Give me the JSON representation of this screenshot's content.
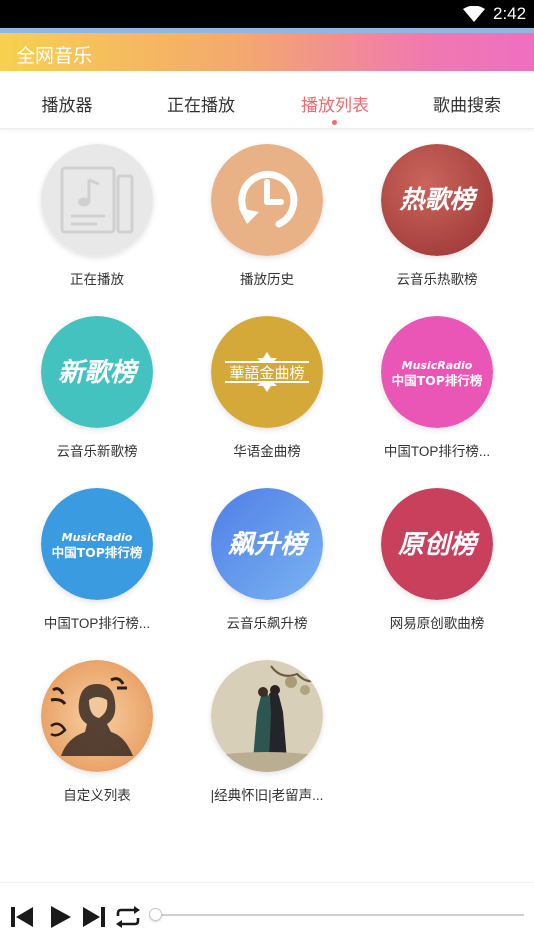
{
  "status": {
    "time": "2:42"
  },
  "app": {
    "title": "全网音乐"
  },
  "tabs": [
    {
      "label": "播放器",
      "active": false
    },
    {
      "label": "正在播放",
      "active": false
    },
    {
      "label": "播放列表",
      "active": true
    },
    {
      "label": "歌曲搜索",
      "active": false
    }
  ],
  "playlists": [
    {
      "label": "正在播放",
      "cover_text": "",
      "icon": "playlist-note-icon",
      "color": "#e6e6e6"
    },
    {
      "label": "播放历史",
      "cover_text": "",
      "icon": "history-clock-icon",
      "color": "#e8b186"
    },
    {
      "label": "云音乐热歌榜",
      "cover_text": "热歌榜",
      "icon": "",
      "color": "#b84d48"
    },
    {
      "label": "云音乐新歌榜",
      "cover_text": "新歌榜",
      "icon": "",
      "color": "#43c2c0"
    },
    {
      "label": "华语金曲榜",
      "cover_text": "華語金曲榜",
      "icon": "",
      "color": "#d4a93a"
    },
    {
      "label": "中国TOP排行榜...",
      "cover_text_top": "MusicRadio",
      "cover_text": "中国TOP排行榜",
      "icon": "",
      "color": "#ea56b6"
    },
    {
      "label": "中国TOP排行榜...",
      "cover_text_top": "MusicRadio",
      "cover_text": "中国TOP排行榜",
      "icon": "",
      "color": "#3b9be0"
    },
    {
      "label": "云音乐飙升榜",
      "cover_text": "飙升榜",
      "icon": "",
      "color": "#5f8fe8"
    },
    {
      "label": "网易原创歌曲榜",
      "cover_text": "原创榜",
      "icon": "",
      "color": "#c9405c"
    },
    {
      "label": "自定义列表",
      "cover_text": "",
      "icon": "custom-artwork",
      "color": "#f0b27f"
    },
    {
      "label": "|经典怀旧|老留声...",
      "cover_text": "",
      "icon": "classic-artwork",
      "color": "#d8cfb8"
    }
  ],
  "player": {
    "progress": 0
  }
}
